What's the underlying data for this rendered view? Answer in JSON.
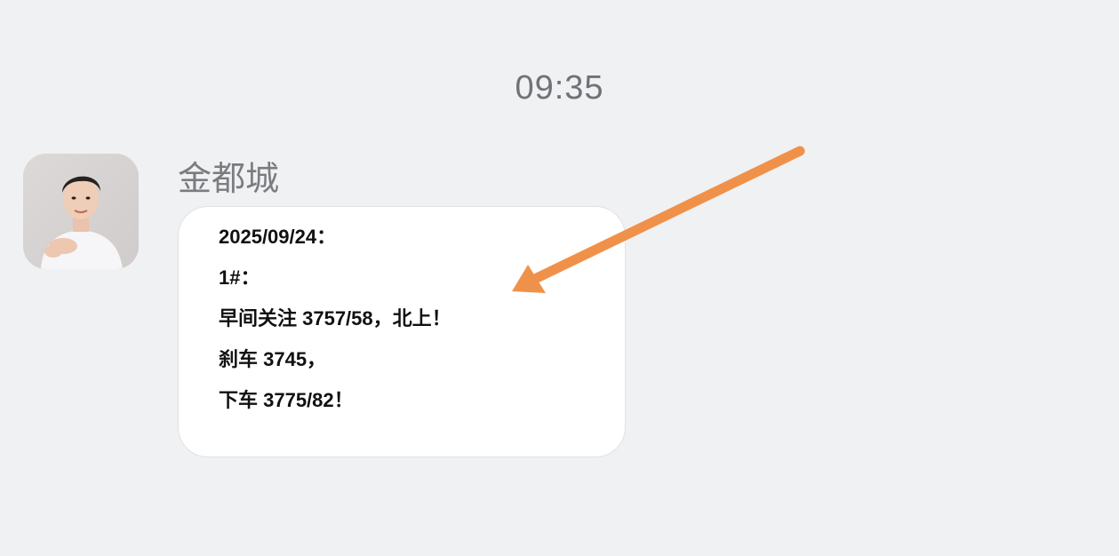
{
  "chat": {
    "timestamp": "09:35",
    "sender": {
      "name": "金都城",
      "avatar": "avatar-photo"
    },
    "message": {
      "lines": [
        "2025/09/24：",
        "1#：",
        "早间关注 3757/58，北上！",
        "刹车 3745，",
        "下车 3775/82！"
      ]
    }
  },
  "annotation": {
    "arrow_color": "#f0914a",
    "icon": "arrow-pointer-icon"
  }
}
